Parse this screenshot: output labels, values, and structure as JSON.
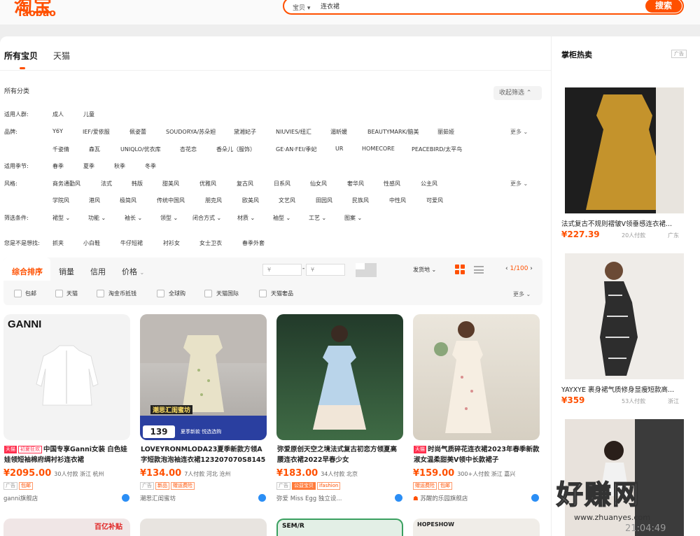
{
  "header": {
    "logo_cn": "淘宝",
    "logo_en": "Taobao",
    "search_type": "宝贝",
    "search_value": "连衣裙",
    "search_button": "搜索"
  },
  "tabs": [
    "所有宝贝",
    "天猫"
  ],
  "filters": {
    "category_title": "所有分类",
    "collapse_label": "收起筛选",
    "more_label": "更多",
    "audience": {
      "label": "适用人群:",
      "items": [
        "成人",
        "儿童"
      ]
    },
    "brand": {
      "label": "品牌:",
      "row1": [
        "Y6Y",
        "IEF/爱依服",
        "佩姿蕾",
        "SOUDORYA/苏朵妲",
        "黛湘妃子",
        "NIUVIES/纽汇",
        "湄昕媛",
        "BEAUTYMARK/脑美",
        "丽茹娅"
      ],
      "row2": [
        "千姿倩",
        "森瓦",
        "UNIQLO/优衣库",
        "杏花恋",
        "香朵儿（服饰）",
        "GE·AN·FEI/季妃",
        "UR",
        "HOMECORE",
        "PEACEBIRD/太平鸟"
      ]
    },
    "season": {
      "label": "适用季节:",
      "items": [
        "春季",
        "夏季",
        "秋季",
        "冬季"
      ]
    },
    "style": {
      "label": "风格:",
      "row1": [
        "商务通勤风",
        "法式",
        "韩版",
        "甜美风",
        "优雅风",
        "复古风",
        "日系风",
        "仙女风",
        "奢华风",
        "性感风",
        "公主风"
      ],
      "row2": [
        "学院风",
        "港风",
        "极简风",
        "传统中国风",
        "朋克风",
        "欧美风",
        "文艺风",
        "田园风",
        "民族风",
        "中性风",
        "可爱风"
      ]
    },
    "conditions": {
      "label": "筛选条件:",
      "items": [
        "裙型",
        "功能",
        "袖长",
        "领型",
        "闭合方式",
        "材质",
        "袖型",
        "工艺",
        "图案"
      ]
    },
    "suggest": {
      "label": "您是不是想找:",
      "items": [
        "抓夹",
        "小白鞋",
        "牛仔短裙",
        "衬衫女",
        "女士卫衣",
        "春季外套"
      ]
    }
  },
  "sortbar": {
    "options": [
      "综合排序",
      "销量",
      "信用",
      "价格"
    ],
    "price_placeholder": "¥",
    "shipping": "发货地",
    "page": "1/100",
    "checkboxes": [
      "包邮",
      "天猫",
      "淘金币抵钱",
      "全球购",
      "天猫国际",
      "天猫奢品"
    ],
    "more": "更多"
  },
  "products": [
    {
      "tags": [
        "天猫",
        "初夏狂欢"
      ],
      "title": "中国专享Ganni女装 白色娃娃领短袖棉府绸衬衫连衣裙",
      "price": "¥2095.00",
      "sales": "30人付款",
      "location": "浙江  杭州",
      "badges": [
        "广告",
        "包邮"
      ],
      "shop": "ganni旗舰店",
      "brand_text": "GANNI"
    },
    {
      "tags": [],
      "title": "LOVEYRONMLODA23夏季新款方领A字短款泡泡袖连衣裙123207070S8145",
      "price": "¥134.00",
      "sales": "7人付款",
      "location": "河北  沧州",
      "badges": [
        "广告",
        "新品",
        "赠运费险"
      ],
      "shop": "潮思汇闺蜜坊",
      "brand_text": "潮思汇闺蜜坊",
      "overlay_num": "139",
      "overlay_text": "夏季新款 悦选选购"
    },
    {
      "tags": [],
      "title": "弥爱原创天空之境法式复古初恋方领夏高腰连衣裙2022早春少女",
      "price": "¥183.00",
      "sales": "34人付款",
      "location": "北京",
      "badges": [
        "广告",
        "公益宝贝",
        "ifashion"
      ],
      "shop": "弥爱 Miss Egg 独立设..."
    },
    {
      "tags": [
        "天猫"
      ],
      "title": "时尚气质碎花连衣裙2023年春季新款淑女温柔甜美V领中长款裙子",
      "price": "¥159.00",
      "sales": "300+人付款",
      "location": "浙江  嘉兴",
      "badges": [
        "赠运费险",
        "包邮"
      ],
      "shop": "苏醒的乐园旗舰店"
    }
  ],
  "bottom_cards": [
    "百亿补贴",
    "",
    "SEM/R",
    "HOPESHOW"
  ],
  "right_panel": {
    "title": "掌柜热卖",
    "ad": "广告",
    "items": [
      {
        "title": "法式复古不规则褶皱V领垂感连衣裙...",
        "price": "¥227.39",
        "sales": "20人付款",
        "location": "广东"
      },
      {
        "title": "YAYXYE 裹身裙气质修身显瘦短款高...",
        "price": "¥359",
        "sales": "53人付款",
        "location": "浙江"
      }
    ]
  },
  "watermark": {
    "big": "好赚网",
    "url": "www.zhuanyes.com",
    "time": "21:04:49"
  }
}
